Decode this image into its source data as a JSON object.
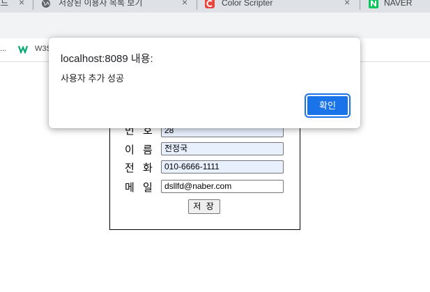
{
  "browser": {
    "tabs": [
      {
        "title": "코드"
      },
      {
        "title": "저장된 이용자 목록 보기"
      },
      {
        "title": "Color Scripter"
      },
      {
        "title": "NAVER"
      }
    ],
    "close_glyph": "×",
    "bookmarks": {
      "overflow": "...",
      "w3_label": "W3S"
    }
  },
  "form": {
    "rows": [
      {
        "label": "번 호",
        "value": "28"
      },
      {
        "label": "이 름",
        "value": "전정국"
      },
      {
        "label": "전 화",
        "value": "010-6666-1111"
      },
      {
        "label": "메 일",
        "value": "dsllfd@naber.com"
      }
    ],
    "save_label": "저 장"
  },
  "dialog": {
    "title": "localhost:8089 내용:",
    "message": "사용자 추가 성공",
    "ok_label": "확인"
  },
  "colors": {
    "accent": "#1a73e8",
    "autofill": "#e8f0fe",
    "tabstrip": "#dee1e6"
  }
}
